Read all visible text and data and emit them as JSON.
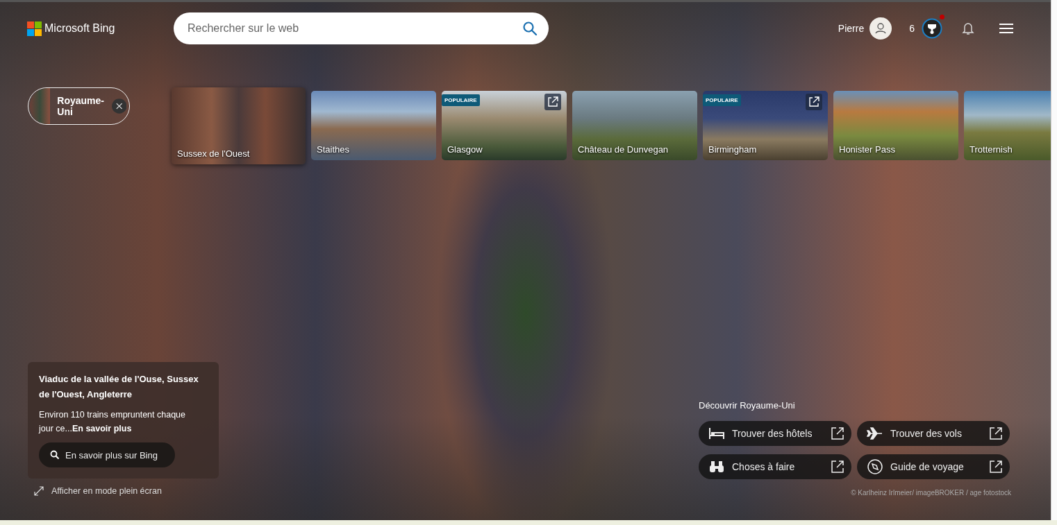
{
  "header": {
    "logo": "Microsoft Bing",
    "search": {
      "placeholder": "Rechercher sur le web"
    },
    "user": {
      "name": "Pierre"
    },
    "rewards": {
      "points": "6",
      "notification": true
    }
  },
  "filter_chip": {
    "label": "Royaume-Uni"
  },
  "destinations": [
    {
      "name": "Sussex de l'Ouest",
      "selected": true,
      "external_link": false
    },
    {
      "name": "Staithes",
      "selected": false,
      "external_link": false
    },
    {
      "name": "Glasgow",
      "selected": false,
      "badge": "POPULAIRE",
      "external_link": true
    },
    {
      "name": "Château de Dunvegan",
      "selected": false,
      "external_link": false
    },
    {
      "name": "Birmingham",
      "selected": false,
      "badge": "POPULAIRE",
      "external_link": true
    },
    {
      "name": "Honister Pass",
      "selected": false,
      "external_link": false
    },
    {
      "name": "Trotternish",
      "selected": false,
      "external_link": false
    }
  ],
  "info_card": {
    "title": "Viaduc de la vallée de l'Ouse, Sussex de l'Ouest, Angleterre",
    "description": "Environ 110 trains empruntent chaque jour ce...",
    "link": "En savoir plus",
    "button": "En savoir plus sur Bing"
  },
  "fullscreen_link": "Afficher en mode plein écran",
  "discover": {
    "title": "Découvrir Royaume-Uni",
    "actions": [
      {
        "label": "Trouver des hôtels",
        "kind": "bed"
      },
      {
        "label": "Trouver des vols",
        "kind": "plane"
      },
      {
        "label": "Choses à faire",
        "kind": "binoculars"
      },
      {
        "label": "Guide de voyage",
        "kind": "compass"
      }
    ]
  },
  "credit": "© Karlheinz Irlmeier/ imageBROKER / age fotostock"
}
